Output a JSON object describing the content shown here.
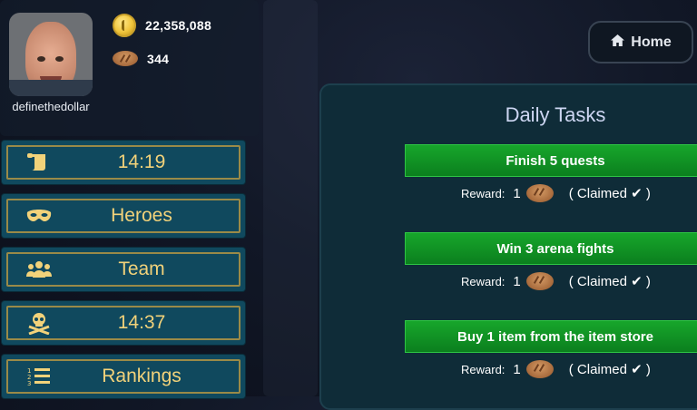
{
  "profile": {
    "username": "definethedollar",
    "gold": "22,358,088",
    "bread": "344"
  },
  "menu": [
    {
      "icon": "scroll-icon",
      "label": "14:19"
    },
    {
      "icon": "mask-icon",
      "label": "Heroes"
    },
    {
      "icon": "team-icon",
      "label": "Team"
    },
    {
      "icon": "skull-crossbones-icon",
      "label": "14:37"
    },
    {
      "icon": "rankings-list-icon",
      "label": "Rankings"
    }
  ],
  "home": {
    "label": "Home"
  },
  "daily_tasks": {
    "title": "Daily Tasks",
    "reward_label": "Reward:",
    "tasks": [
      {
        "name": "Finish 5 quests",
        "reward": "1",
        "status": "( Claimed ✔ )"
      },
      {
        "name": "Win 3 arena fights",
        "reward": "1",
        "status": "( Claimed ✔ )"
      },
      {
        "name": "Buy 1 item from the item store",
        "reward": "1",
        "status": "( Claimed ✔ )"
      }
    ]
  },
  "colors": {
    "menu_bg": "#10495e",
    "menu_text": "#f2d27a",
    "task_green": "#17a62b",
    "panel_bg": "#0f2c38"
  }
}
